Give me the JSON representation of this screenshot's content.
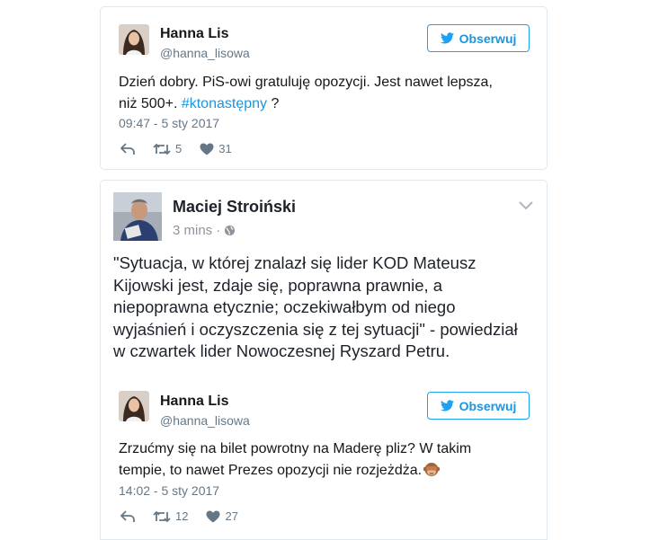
{
  "tweet1": {
    "author_name": "Hanna Lis",
    "author_handle": "@hanna_lisowa",
    "follow_label": "Obserwuj",
    "text_before": "Dzień dobry. PiS-owi gratuluję opozycji. Jest nawet lepsza, niż 500+. ",
    "hashtag": "#ktonastępny",
    "text_after": " ?",
    "timestamp": "09:47 - 5 sty 2017",
    "retweets": "5",
    "likes": "31"
  },
  "fb_post": {
    "author_name": "Maciej Stroiński",
    "time": "3 mins",
    "separator": "·",
    "globe_icon": "globe-icon",
    "text": "\"Sytuacja, w której znalazł się lider KOD Mateusz Kijowski jest, zdaje się, poprawna prawnie, a niepoprawna etycznie; oczekiwałbym od niego wyjaśnień i oczyszczenia się z tej sytuacji\" - powiedział w czwartek lider Nowoczesnej Ryszard Petru."
  },
  "tweet2": {
    "author_name": "Hanna Lis",
    "author_handle": "@hanna_lisowa",
    "follow_label": "Obserwuj",
    "text": "Zrzućmy się na bilet powrotny na Maderę pliz? W takim tempie, to nawet Prezes opozycji nie rozjeżdża.",
    "emoji_icon": "see-no-evil-monkey-icon",
    "timestamp": "14:02 - 5 sty 2017",
    "retweets": "12",
    "likes": "27"
  },
  "colors": {
    "twitter_blue": "#1da1f2",
    "link_blue": "#1b95e0",
    "muted_gray": "#657786",
    "border": "#e1e8ed"
  }
}
